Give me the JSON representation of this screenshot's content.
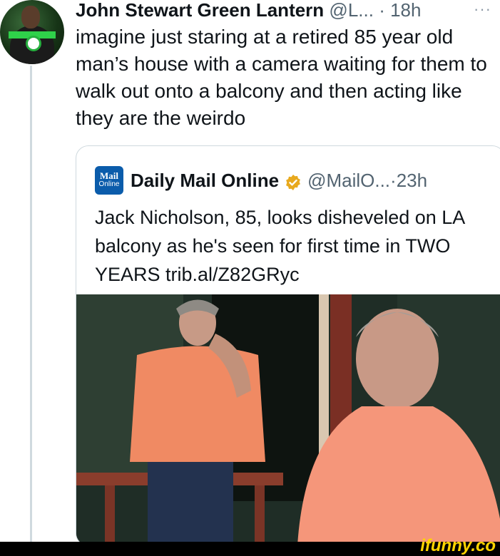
{
  "tweet": {
    "name": "John Stewart Green Lantern",
    "handle": "@L...",
    "separator": "·",
    "time": "18h",
    "more": "···",
    "text": "imagine just staring at a retired 85 year old man’s house with a camera waiting for them to walk out onto a balcony and then acting like they are the weirdo"
  },
  "quote": {
    "logo_line1": "Mail",
    "logo_line2": "Online",
    "name": "Daily Mail Online",
    "handle": "@MailO...",
    "separator": "·",
    "time": "23h",
    "text": "Jack Nicholson, 85, looks disheveled on LA balcony as he's seen for first time in TWO YEARS trib.al/Z82GRyc",
    "badge_color": "#e8a91d"
  },
  "watermark": "ifunny.co"
}
